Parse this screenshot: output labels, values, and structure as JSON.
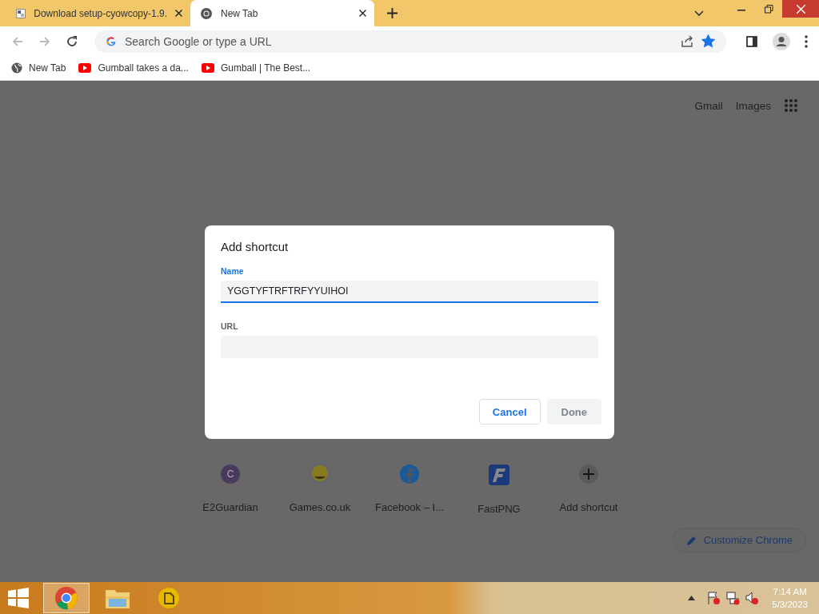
{
  "tabs": [
    {
      "title": "Download setup-cyowcopy-1.9.",
      "selected": false
    },
    {
      "title": "New Tab",
      "selected": true
    }
  ],
  "address_bar": {
    "placeholder": "Search Google or type a URL",
    "bookmarked": true
  },
  "bookmarks": [
    {
      "title": "New Tab"
    },
    {
      "title": "Gumball takes a da..."
    },
    {
      "title": "Gumball | The Best..."
    }
  ],
  "top_links": [
    "Gmail",
    "Images"
  ],
  "shortcuts": [
    {
      "title": "E2Guardian",
      "kind": "letter",
      "letter": "C",
      "color": "#4a3a5a"
    },
    {
      "title": "Games.co.uk",
      "kind": "mascot",
      "color": "#8a7a20"
    },
    {
      "title": "Facebook – I...",
      "kind": "facebook",
      "color": "#1a5a9a"
    },
    {
      "title": "FastPNG",
      "kind": "fastpng",
      "color": "#1c3a7a"
    },
    {
      "title": "Add shortcut",
      "kind": "add",
      "color": "#5a5a5a"
    }
  ],
  "customize_button": "Customize Chrome",
  "dialog": {
    "title": "Add shortcut",
    "fields": [
      {
        "label": "Name",
        "value": "YGGTYFTRFTRFYYUIHOI",
        "focused": true
      },
      {
        "label": "URL",
        "focused": false
      }
    ],
    "buttons": [
      {
        "label": "Cancel",
        "disabled": false
      },
      {
        "label": "Done",
        "disabled": true
      }
    ]
  },
  "taskbar": {
    "apps": [
      {
        "kind": "chrome",
        "selected": true
      },
      {
        "kind": "explorer",
        "selected": false
      },
      {
        "kind": "app",
        "selected": false
      }
    ],
    "time": "7:14 AM",
    "date": "5/3/2023"
  }
}
